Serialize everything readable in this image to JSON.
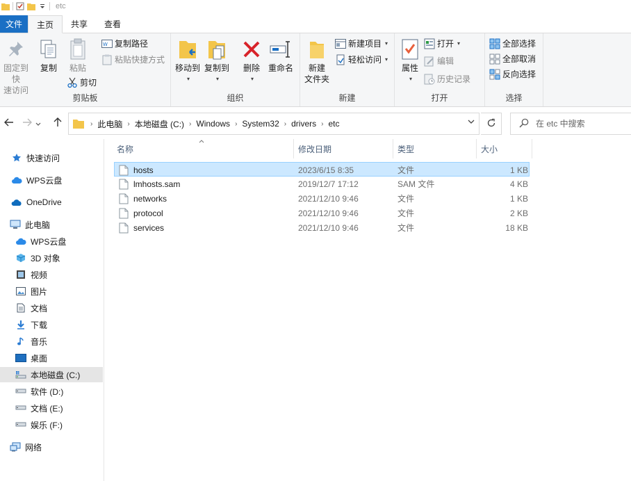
{
  "window": {
    "title": "etc"
  },
  "quick_access_toolbar": {
    "icons": [
      "folder-icon",
      "checkbox-icon",
      "folder-icon",
      "dropdown-icon"
    ]
  },
  "tabs": [
    {
      "label": "文件"
    },
    {
      "label": "主页"
    },
    {
      "label": "共享"
    },
    {
      "label": "查看"
    }
  ],
  "ribbon": {
    "clipboard": {
      "label": "剪贴板",
      "pin_quick_access": "固定到快\n速访问",
      "copy": "复制",
      "paste": "粘贴",
      "copy_path": "复制路径",
      "paste_shortcut": "粘贴快捷方式",
      "cut": "剪切"
    },
    "organize": {
      "label": "组织",
      "move_to": "移动到",
      "copy_to": "复制到",
      "delete": "删除",
      "rename": "重命名"
    },
    "new": {
      "label": "新建",
      "new_folder": "新建\n文件夹",
      "new_item": "新建项目",
      "easy_access": "轻松访问"
    },
    "open": {
      "label": "打开",
      "properties": "属性",
      "open": "打开",
      "edit": "编辑",
      "history": "历史记录"
    },
    "select": {
      "label": "选择",
      "select_all": "全部选择",
      "select_none": "全部取消",
      "invert": "反向选择"
    }
  },
  "address": {
    "breadcrumbs": [
      "此电脑",
      "本地磁盘 (C:)",
      "Windows",
      "System32",
      "drivers",
      "etc"
    ]
  },
  "search": {
    "placeholder": "在 etc 中搜索"
  },
  "nav_pane": [
    {
      "label": "快速访问",
      "icon": "star-icon"
    },
    {
      "label": "WPS云盘",
      "icon": "cloud-icon"
    },
    {
      "label": "OneDrive",
      "icon": "onedrive-icon"
    },
    {
      "label": "此电脑",
      "icon": "computer-icon"
    },
    {
      "label": "WPS云盘",
      "icon": "cloud-icon"
    },
    {
      "label": "3D 对象",
      "icon": "cube-icon"
    },
    {
      "label": "视频",
      "icon": "video-icon"
    },
    {
      "label": "图片",
      "icon": "picture-icon"
    },
    {
      "label": "文档",
      "icon": "document-icon"
    },
    {
      "label": "下载",
      "icon": "download-icon"
    },
    {
      "label": "音乐",
      "icon": "music-icon"
    },
    {
      "label": "桌面",
      "icon": "desktop-icon"
    },
    {
      "label": "本地磁盘 (C:)",
      "icon": "drive-icon"
    },
    {
      "label": "软件 (D:)",
      "icon": "drive-icon"
    },
    {
      "label": "文档 (E:)",
      "icon": "drive-icon"
    },
    {
      "label": "娱乐 (F:)",
      "icon": "drive-icon"
    },
    {
      "label": "网络",
      "icon": "network-icon"
    }
  ],
  "file_list": {
    "columns": [
      "名称",
      "修改日期",
      "类型",
      "大小"
    ],
    "rows": [
      {
        "name": "hosts",
        "modified": "2023/6/15 8:35",
        "type": "文件",
        "size": "1 KB"
      },
      {
        "name": "lmhosts.sam",
        "modified": "2019/12/7 17:12",
        "type": "SAM 文件",
        "size": "4 KB"
      },
      {
        "name": "networks",
        "modified": "2021/12/10 9:46",
        "type": "文件",
        "size": "1 KB"
      },
      {
        "name": "protocol",
        "modified": "2021/12/10 9:46",
        "type": "文件",
        "size": "2 KB"
      },
      {
        "name": "services",
        "modified": "2021/12/10 9:46",
        "type": "文件",
        "size": "18 KB"
      }
    ]
  },
  "colors": {
    "accent": "#1a6fc4",
    "selection": "#cce8ff",
    "selection_border": "#99d1ff"
  }
}
